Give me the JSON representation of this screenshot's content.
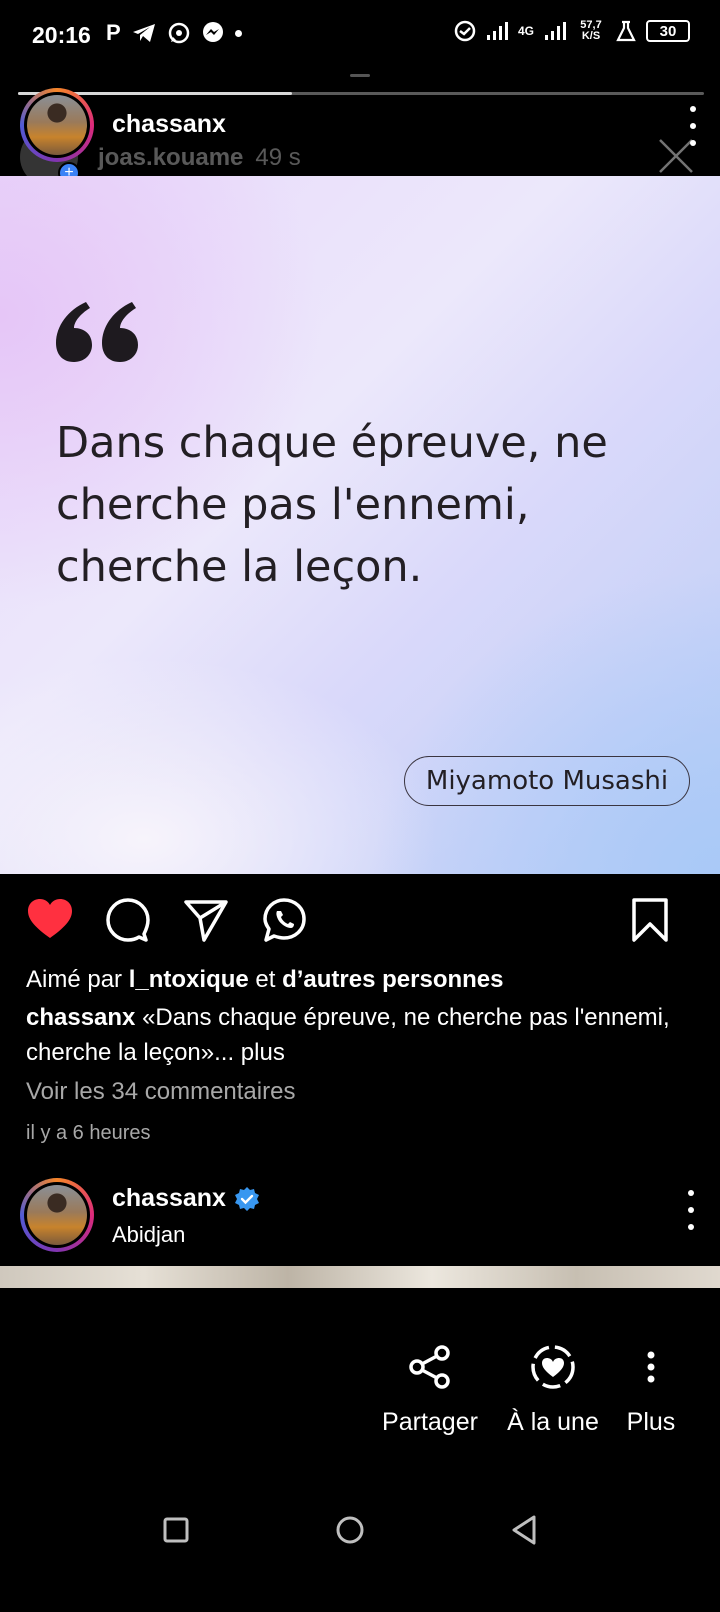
{
  "status_bar": {
    "time": "20:16",
    "left_icons": [
      "P",
      "telegram-icon",
      "whatsapp-icon",
      "messenger-icon",
      "dot"
    ],
    "network_type": "4G",
    "data_speed": "57,7 K/S",
    "battery": "30"
  },
  "story": {
    "username": "chassanx",
    "sub_username": "joas.kouame",
    "time": "49 s",
    "progress": 0.4
  },
  "post": {
    "quote": "Dans chaque épreuve, ne cherche pas l'ennemi, cherche la leçon.",
    "author": "Miyamoto Musashi",
    "liked_prefix": "Aimé par",
    "liked_user": "l_ntoxique",
    "liked_mid": "et",
    "liked_others": "d’autres personnes",
    "caption_user": "chassanx",
    "caption_text": "«Dans chaque épreuve, ne cherche pas l'ennemi, cherche la leçon»...",
    "caption_more": "plus",
    "comments_link": "Voir les 34 commentaires",
    "time_ago": "il y a 6 heures",
    "liked": true
  },
  "next_post": {
    "username": "chassanx",
    "location": "Abidjan",
    "verified": true
  },
  "sheet": {
    "share": "Partager",
    "highlight": "À la une",
    "more": "Plus"
  },
  "colors": {
    "like_red": "#ff3040",
    "verified_blue": "#3897f0",
    "muted_gray": "#a8a8a8"
  }
}
